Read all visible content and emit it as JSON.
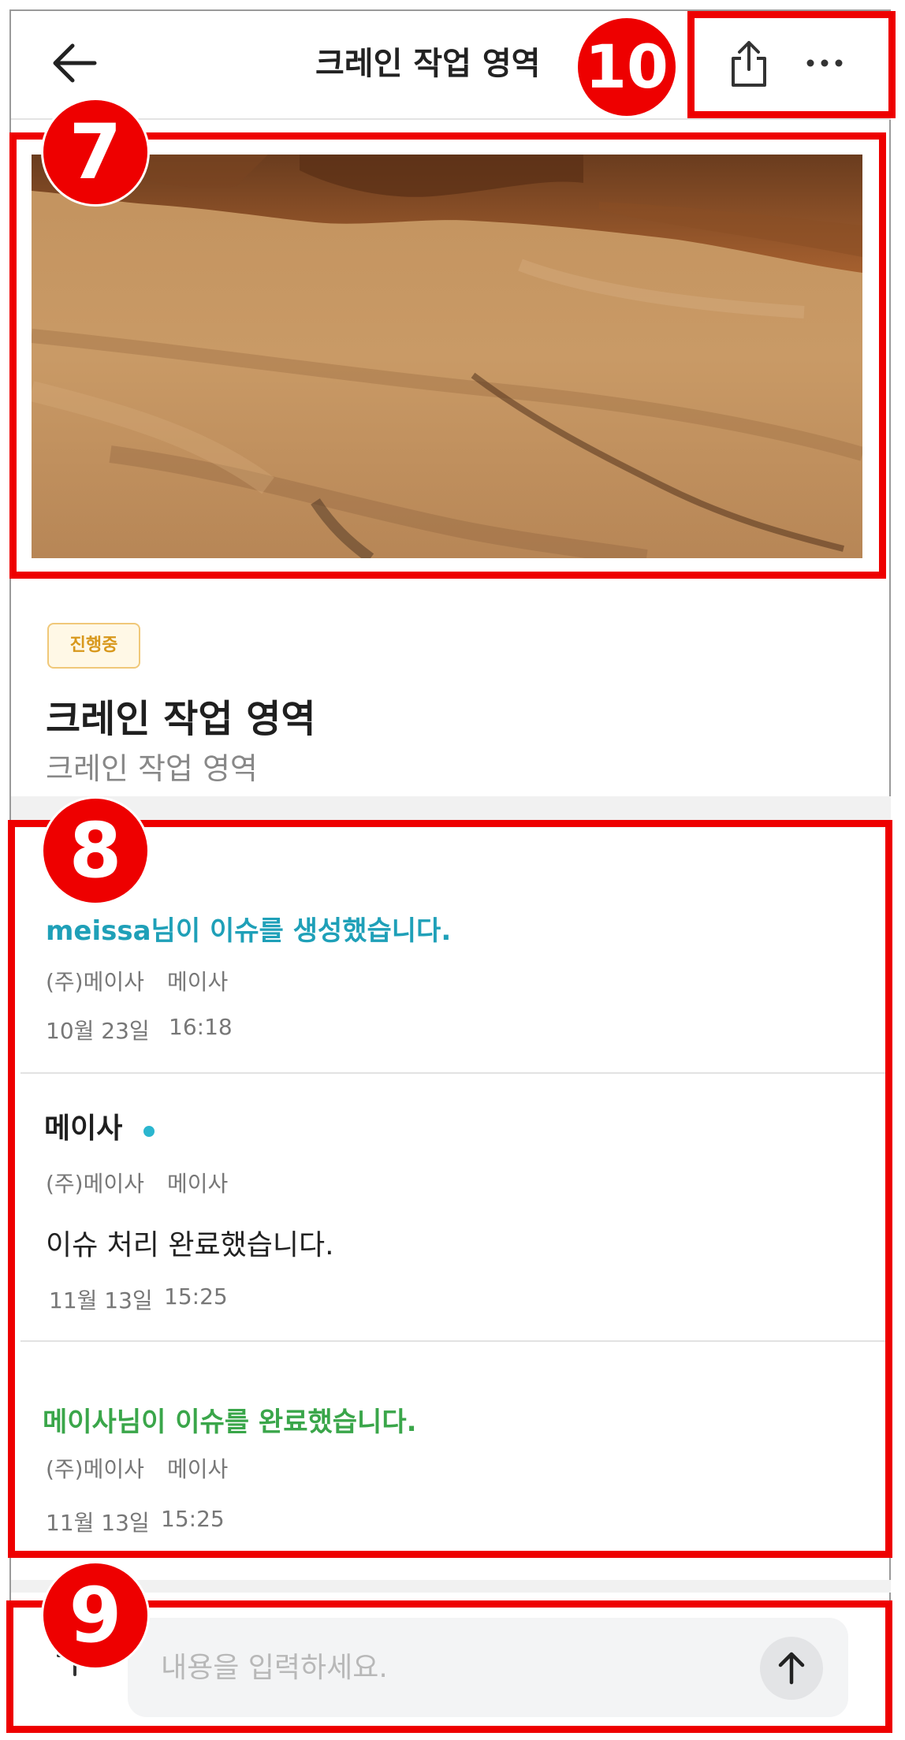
{
  "header": {
    "back_icon": "arrow-left-icon",
    "title": "크레인 작업 영역",
    "share_icon": "share-icon",
    "more_icon": "more-horizontal-icon"
  },
  "issue": {
    "status": "진행중",
    "title": "크레인 작업 영역",
    "subtitle": "크레인 작업 영역"
  },
  "activity": [
    {
      "type": "created",
      "text": "meissa님이 이슈를 생성했습니다.",
      "company": "(주)메이사",
      "user": "메이사",
      "date": "10월 23일",
      "time": "16:18"
    },
    {
      "type": "comment",
      "author": "메이사",
      "company": "(주)메이사",
      "user": "메이사",
      "text": "이슈 처리 완료했습니다.",
      "date": "11월 13일",
      "time": "15:25"
    },
    {
      "type": "completed",
      "text": "메이사님이 이슈를 완료했습니다.",
      "company": "(주)메이사",
      "user": "메이사",
      "date": "11월 13일",
      "time": "15:25"
    }
  ],
  "input": {
    "placeholder": "내용을 입력하세요.",
    "plus_icon": "plus-icon",
    "send_icon": "send-arrow-up-icon"
  },
  "colors": {
    "accent_created": "#1fa0b8",
    "accent_completed": "#3aa64a",
    "status_badge": "#d8981c",
    "annotation": "#ee0000"
  },
  "annotations": [
    "7",
    "8",
    "9",
    "10"
  ]
}
